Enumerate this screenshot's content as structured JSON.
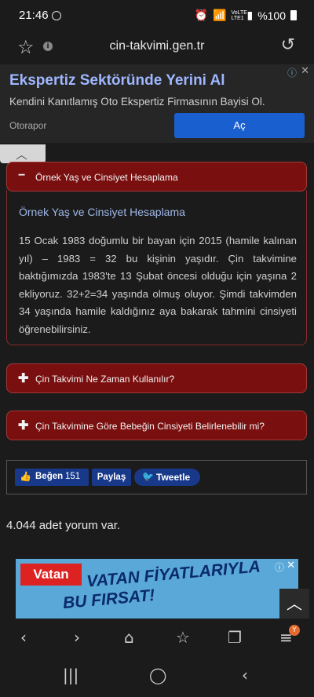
{
  "status": {
    "time": "21:46",
    "network": "VoLTE LTE1",
    "battery": "%100"
  },
  "browser": {
    "url": "cin-takvimi.gen.tr"
  },
  "ad_top": {
    "headline": "Ekspertiz Sektöründe Yerini Al",
    "subline": "Kendini Kanıtlamış Oto Ekspertiz Firmasının Bayisi Ol.",
    "advertiser": "Otorapor",
    "cta": "Aç"
  },
  "accordion": [
    {
      "title": "Örnek Yaş ve Cinsiyet Hesaplama",
      "expanded": true,
      "body_title": "Örnek Yaş ve Cinsiyet Hesaplama",
      "body_text": "15 Ocak 1983 doğumlu bir bayan için 2015 (hamile kalınan yıl) – 1983 = 32 bu kişinin yaşıdır. Çin takvimine baktığımızda 1983'te 13 Şubat öncesi olduğu için yaşına 2 ekliyoruz. 32+2=34 yaşında olmuş oluyor. Şimdi takvimden 34 yaşında hamile kaldığınız aya bakarak tahmini cinsiyeti öğrenebilirsiniz."
    },
    {
      "title": "Çin Takvimi Ne Zaman Kullanılır?",
      "expanded": false
    },
    {
      "title": "Çin Takvimine Göre Bebeğin Cinsiyeti Belirlenebilir mi?",
      "expanded": false
    }
  ],
  "share": {
    "like_label": "Beğen",
    "like_count": "151",
    "share_label": "Paylaş",
    "tweet_label": "Tweetle"
  },
  "comments": {
    "count_text": "4.044 adet yorum var."
  },
  "ad_bottom": {
    "brand": "Vatan",
    "slogan_line1": "VATAN FİYATLARIYLA",
    "slogan_line2": "BU FIRSAT!"
  },
  "nav": {
    "tabs_badge": "Y"
  },
  "icons": {
    "minus": "−",
    "plus": "✚",
    "star": "☆",
    "reload": "↺",
    "back": "‹",
    "forward": "›",
    "home": "⌂",
    "bookmarks": "☆",
    "tabs": "❐",
    "menu": "≡",
    "recents": "|||",
    "homebtn": "◯",
    "sysback": "‹",
    "up": "︿"
  },
  "colors": {
    "accordion_bg": "#7a0f0f",
    "accordion_border": "#a03a3a",
    "ad_cta": "#1a5fd0",
    "share_bg": "#18398a"
  }
}
